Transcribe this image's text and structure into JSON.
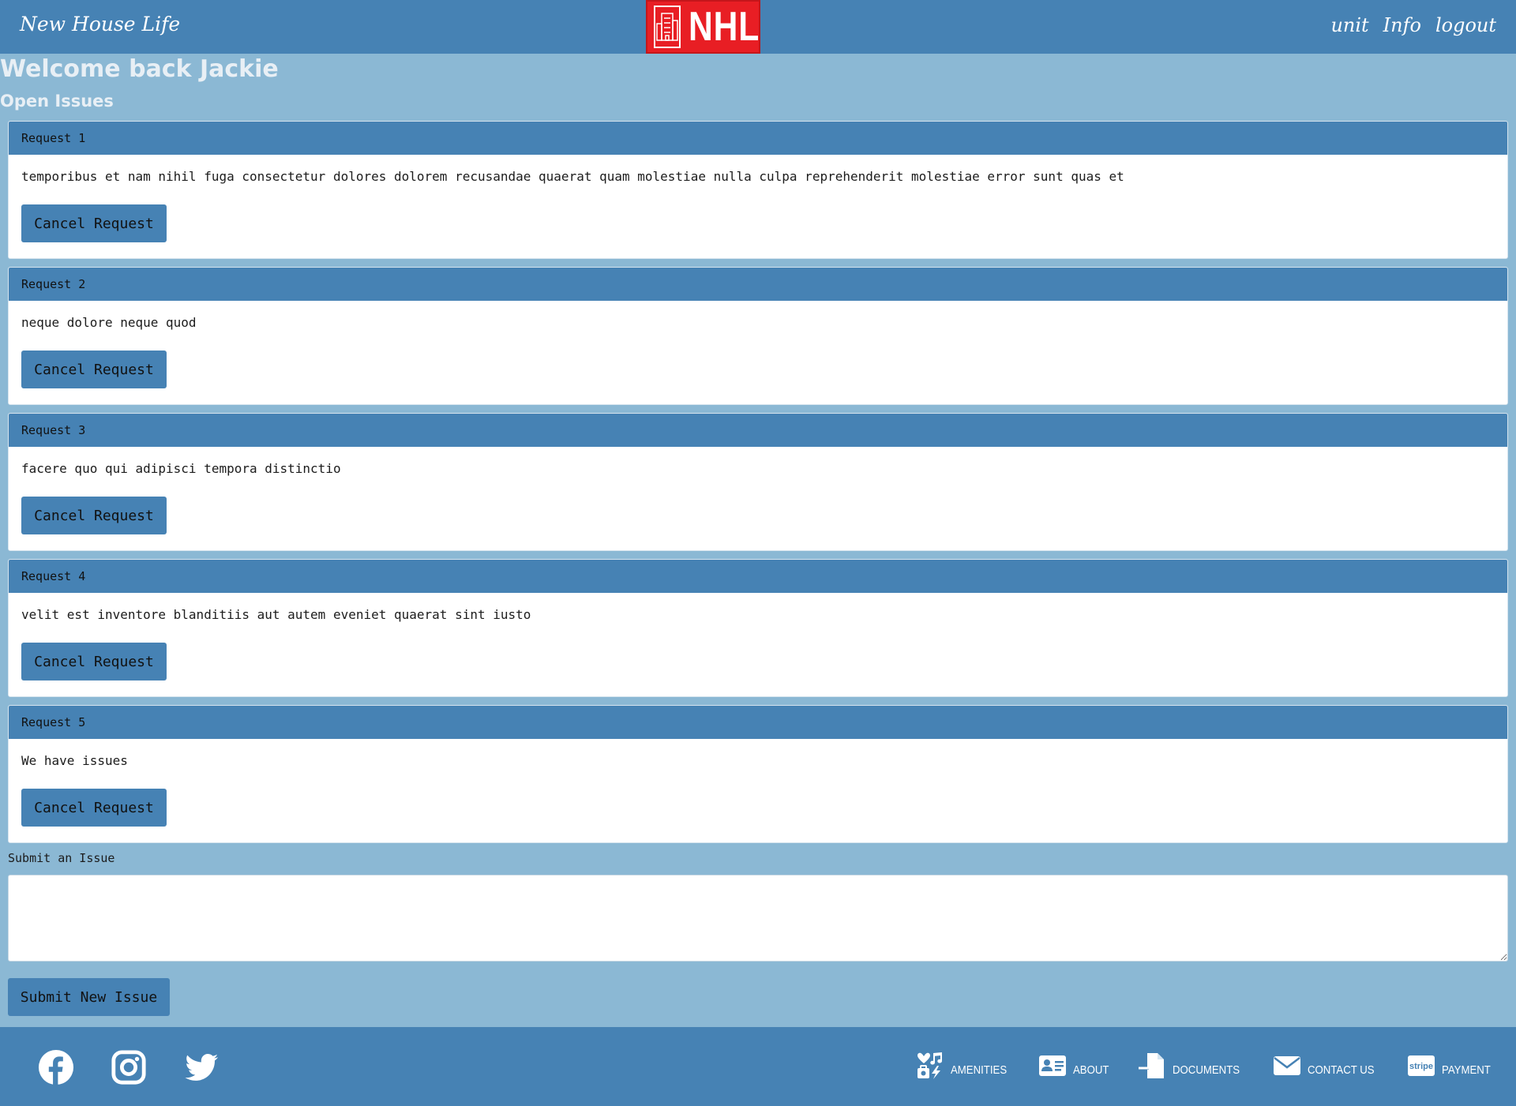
{
  "header": {
    "brand": "New House Life",
    "logo_text": "NHL",
    "nav": [
      {
        "label": "unit"
      },
      {
        "label": "Info"
      },
      {
        "label": "logout"
      }
    ]
  },
  "welcome_title": "Welcome back Jackie",
  "open_issues_title": "Open Issues",
  "requests": [
    {
      "title": "Request 1",
      "text": "temporibus et nam nihil fuga consectetur dolores dolorem recusandae quaerat quam molestiae nulla culpa reprehenderit molestiae error sunt quas et",
      "button": "Cancel Request"
    },
    {
      "title": "Request 2",
      "text": "neque dolore neque quod",
      "button": "Cancel Request"
    },
    {
      "title": "Request 3",
      "text": "facere quo qui adipisci tempora distinctio",
      "button": "Cancel Request"
    },
    {
      "title": "Request 4",
      "text": "velit est inventore blanditiis aut autem eveniet quaerat sint iusto",
      "button": "Cancel Request"
    },
    {
      "title": "Request 5",
      "text": "We have issues",
      "button": "Cancel Request"
    }
  ],
  "submit": {
    "label": "Submit an Issue",
    "value": "",
    "button": "Submit New Issue"
  },
  "footer": {
    "social": [
      {
        "icon": "facebook-icon"
      },
      {
        "icon": "instagram-icon"
      },
      {
        "icon": "twitter-icon"
      }
    ],
    "links": [
      {
        "label": "AMENITIES",
        "icon": "amenities-icon"
      },
      {
        "label": "ABOUT",
        "icon": "id-card-icon"
      },
      {
        "label": "DOCUMENTS",
        "icon": "document-import-icon"
      },
      {
        "label": "CONTACT US",
        "icon": "envelope-icon"
      },
      {
        "label": "PAYMENT",
        "icon": "stripe-icon"
      }
    ]
  },
  "colors": {
    "background": "#8bb8d4",
    "primary": "#4682b4",
    "logo_red": "#e81e24",
    "card": "#ffffff"
  }
}
